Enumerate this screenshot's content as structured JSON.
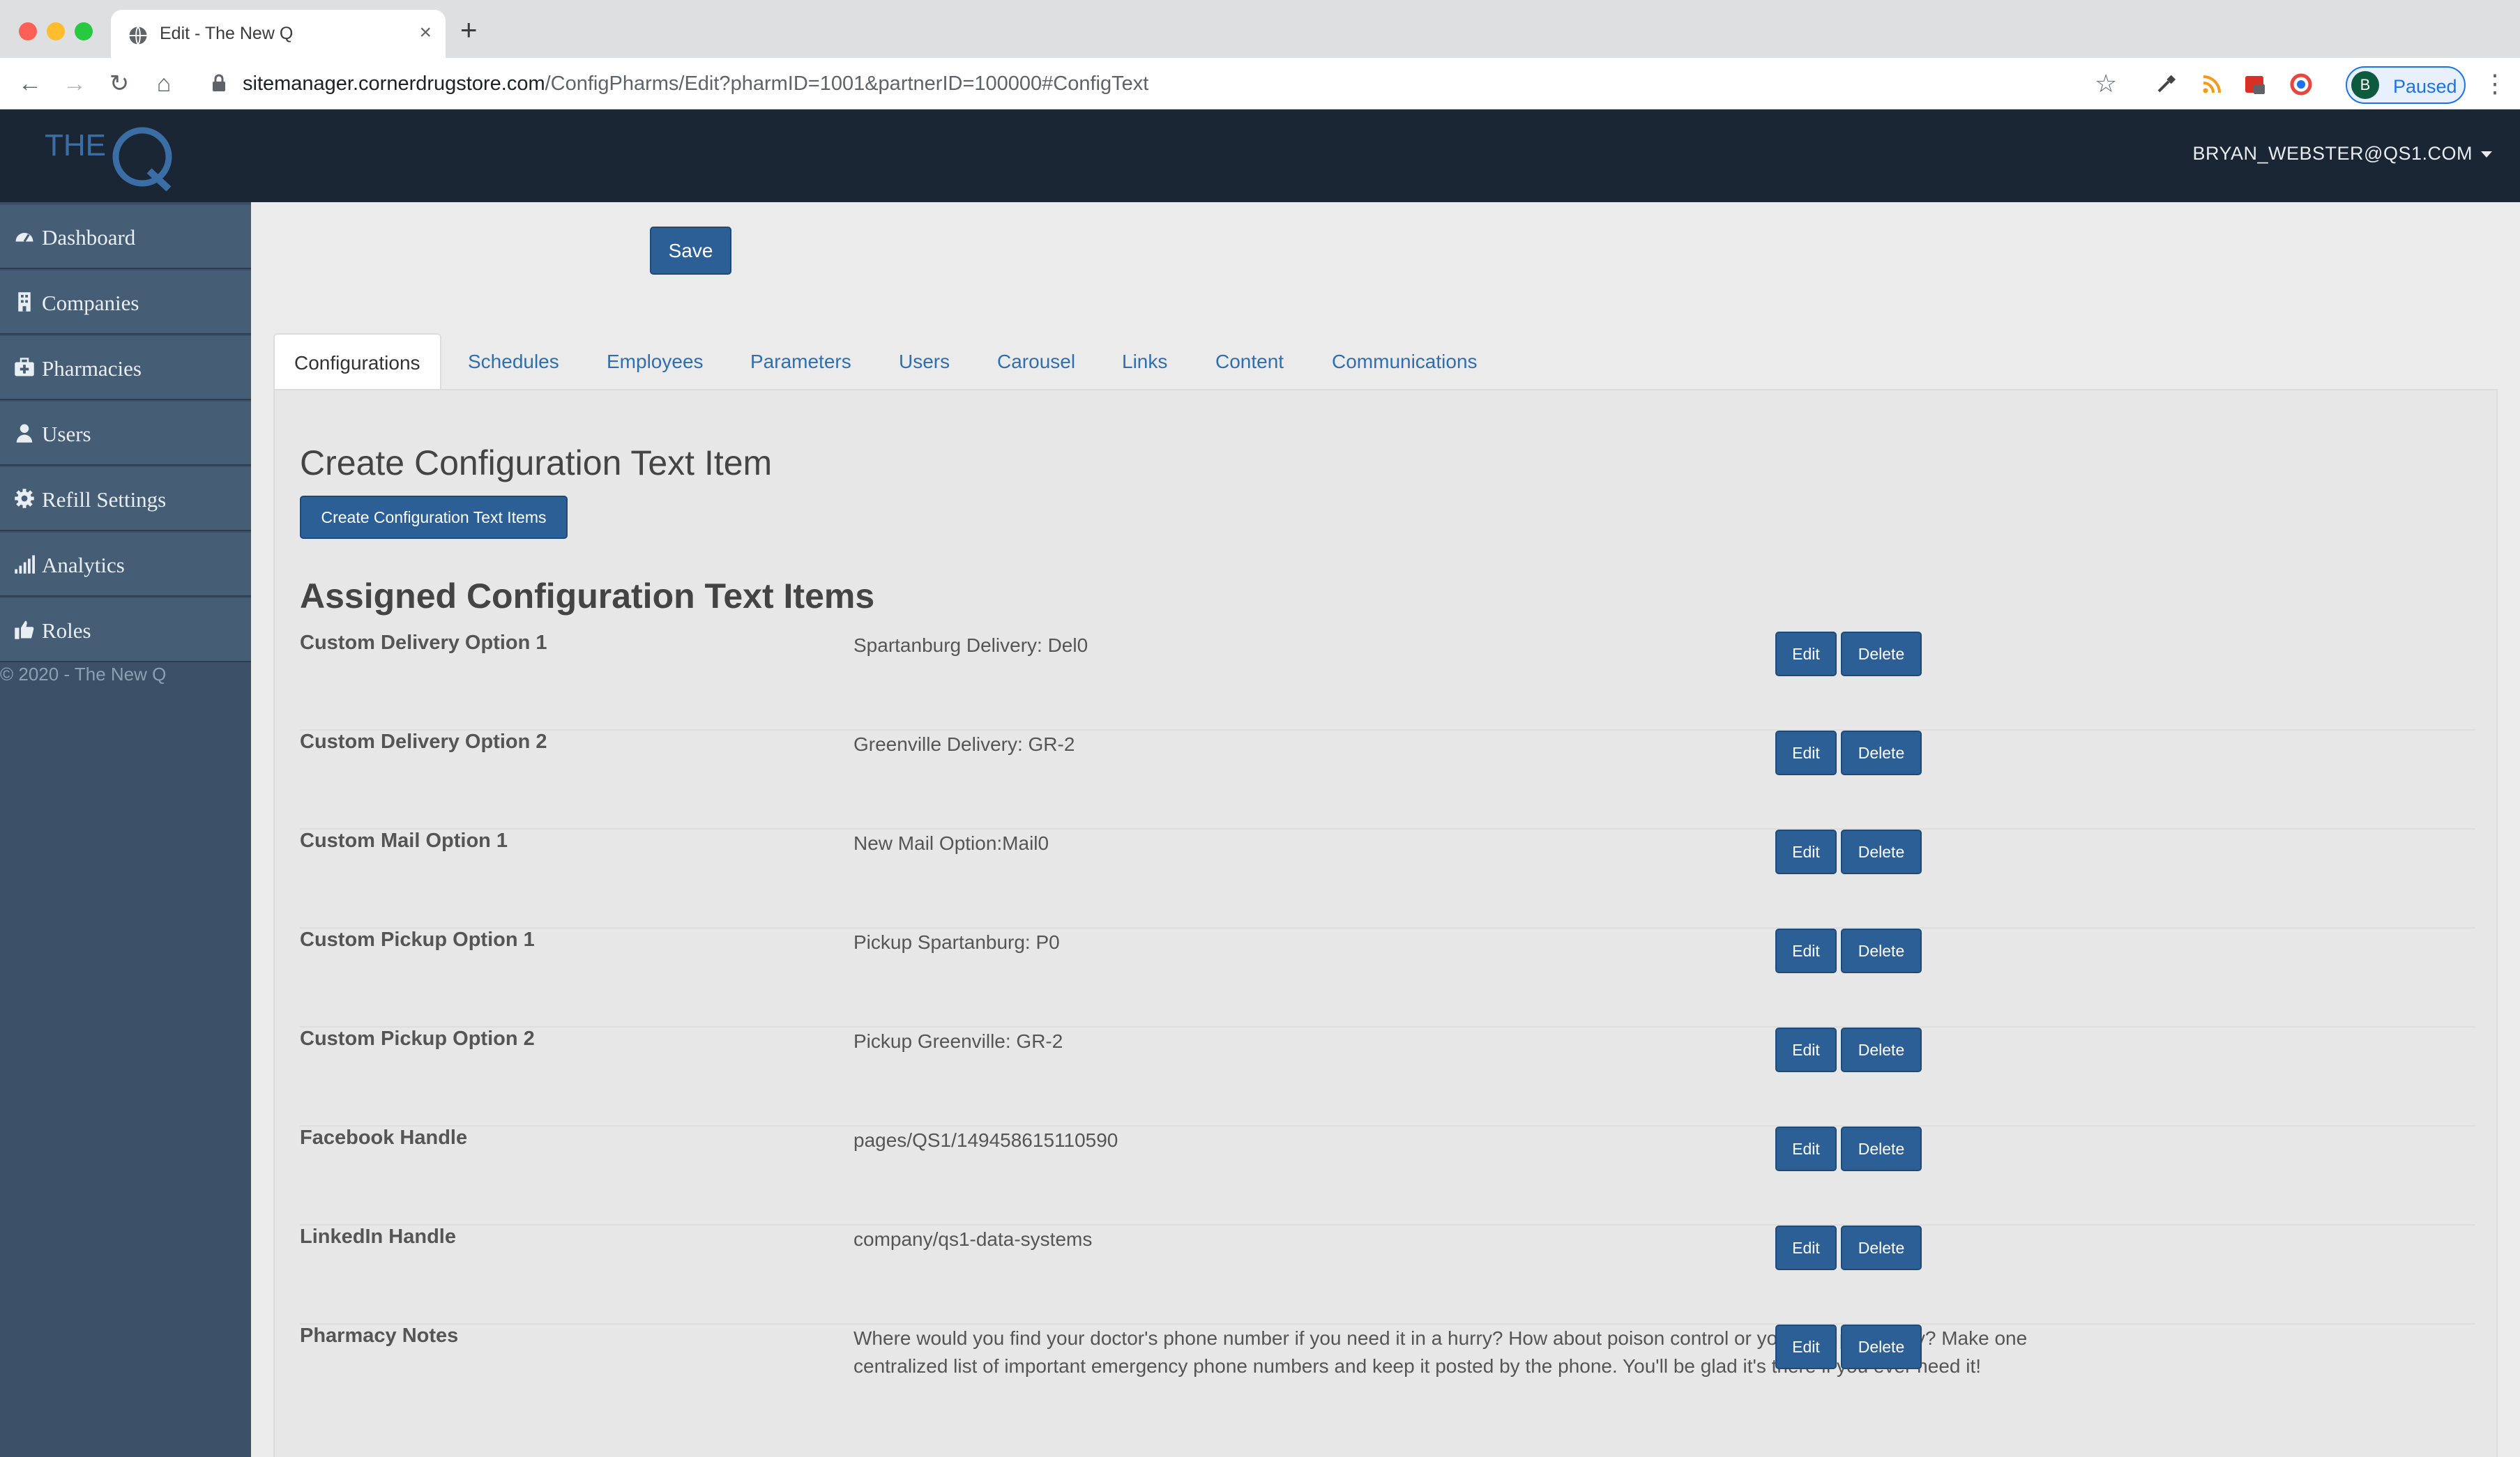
{
  "browser": {
    "tab_title": "Edit - The New Q",
    "new_tab": "+",
    "url_host": "sitemanager.cornerdrugstore.com",
    "url_path": "/ConfigPharms/Edit?pharmID=1001&partnerID=100000#ConfigText",
    "profile_initial": "B",
    "profile_status": "Paused",
    "icons": [
      "back-icon",
      "forward-icon",
      "reload-icon",
      "home-icon",
      "lock-icon",
      "star-icon",
      "eyedropper-icon",
      "rss-icon",
      "calendar-icon",
      "color-icon",
      "menu-icon"
    ]
  },
  "header": {
    "logo_text_the": "THE",
    "logo_text_q": "Q",
    "user": "BRYAN_WEBSTER@QS1.COM"
  },
  "sidebar": {
    "items": [
      {
        "label": "Dashboard",
        "icon": "dashboard-icon"
      },
      {
        "label": "Companies",
        "icon": "building-icon"
      },
      {
        "label": "Pharmacies",
        "icon": "medkit-icon"
      },
      {
        "label": "Users",
        "icon": "user-icon"
      },
      {
        "label": "Refill Settings",
        "icon": "gear-icon"
      },
      {
        "label": "Analytics",
        "icon": "signal-icon"
      },
      {
        "label": "Roles",
        "icon": "thumbs-up-icon"
      }
    ],
    "copyright": "© 2020 - The New Q"
  },
  "main": {
    "save_label": "Save",
    "tabs": [
      "Configurations",
      "Schedules",
      "Employees",
      "Parameters",
      "Users",
      "Carousel",
      "Links",
      "Content",
      "Communications"
    ],
    "active_tab": "Configurations",
    "create_heading": "Create Configuration Text Item",
    "create_button": "Create Configuration Text Items",
    "assigned_heading": "Assigned Configuration Text Items",
    "edit_label": "Edit",
    "delete_label": "Delete",
    "items": [
      {
        "key": "Custom Delivery Option 1",
        "value": "Spartanburg Delivery: Del0"
      },
      {
        "key": "Custom Delivery Option 2",
        "value": "Greenville Delivery: GR-2"
      },
      {
        "key": "Custom Mail Option 1",
        "value": "New Mail Option:Mail0"
      },
      {
        "key": "Custom Pickup Option 1",
        "value": "Pickup Spartanburg: P0"
      },
      {
        "key": "Custom Pickup Option 2",
        "value": "Pickup Greenville: GR-2"
      },
      {
        "key": "Facebook Handle",
        "value": "pages/QS1/149458615110590"
      },
      {
        "key": "LinkedIn Handle",
        "value": "company/qs1-data-systems"
      },
      {
        "key": "Pharmacy Notes",
        "value": "Where would you find your doctor's phone number if you need it in a hurry? How about poison control or you local pharmacy? Make one centralized list of important emergency phone numbers and keep it posted by the phone. You'll be glad it's there if you ever need it!"
      }
    ]
  },
  "colors": {
    "header_bg": "#1b2634",
    "sidebar_bg": "#3c5167",
    "primary_button": "#2c5f95",
    "link": "#2f6fad"
  }
}
